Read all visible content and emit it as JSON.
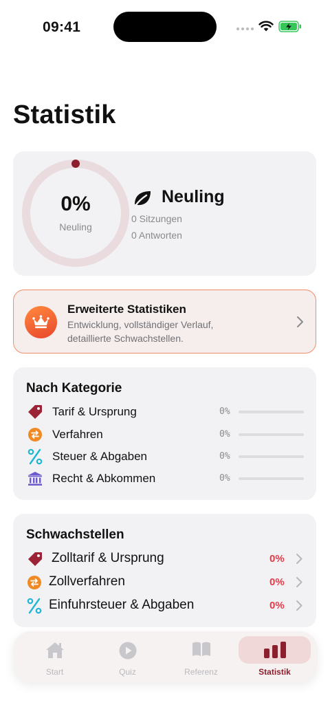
{
  "status_bar": {
    "time": "09:41"
  },
  "page": {
    "title": "Statistik"
  },
  "progress": {
    "percent_label": "0%",
    "percent_value": 0,
    "level_caption": "Neuling",
    "level_name": "Neuling",
    "sessions": "0 Sitzungen",
    "answers": "0 Antworten"
  },
  "premium": {
    "title": "Erweiterte Statistiken",
    "description": "Entwicklung, vollständiger Verlauf, detaillierte Schwachstellen."
  },
  "categories": {
    "title": "Nach Kategorie",
    "items": [
      {
        "label": "Tarif & Ursprung",
        "pct": "0%",
        "value": 0,
        "icon": "price-tag-icon",
        "color": "#9b2335"
      },
      {
        "label": "Verfahren",
        "pct": "0%",
        "value": 0,
        "icon": "swap-arrows-icon",
        "color": "#f08a24"
      },
      {
        "label": "Steuer & Abgaben",
        "pct": "0%",
        "value": 0,
        "icon": "percent-icon",
        "color": "#1fb6d6"
      },
      {
        "label": "Recht & Abkommen",
        "pct": "0%",
        "value": 0,
        "icon": "courthouse-icon",
        "color": "#6a5acd"
      }
    ]
  },
  "weaknesses": {
    "title": "Schwachstellen",
    "items": [
      {
        "label": "Zolltarif & Ursprung",
        "pct": "0%",
        "icon": "price-tag-icon"
      },
      {
        "label": "Zollverfahren",
        "pct": "0%",
        "icon": "swap-arrows-icon"
      },
      {
        "label": "Einfuhrsteuer & Abgaben",
        "pct": "0%",
        "icon": "percent-icon"
      }
    ]
  },
  "tabs": [
    {
      "label": "Start",
      "icon": "house-icon"
    },
    {
      "label": "Quiz",
      "icon": "play-circle-icon"
    },
    {
      "label": "Referenz",
      "icon": "book-icon"
    },
    {
      "label": "Statistik",
      "icon": "bar-chart-icon",
      "active": true
    }
  ],
  "colors": {
    "accent": "#8b1f2e",
    "danger": "#e53a48",
    "premium_border": "#ef8c6e"
  }
}
